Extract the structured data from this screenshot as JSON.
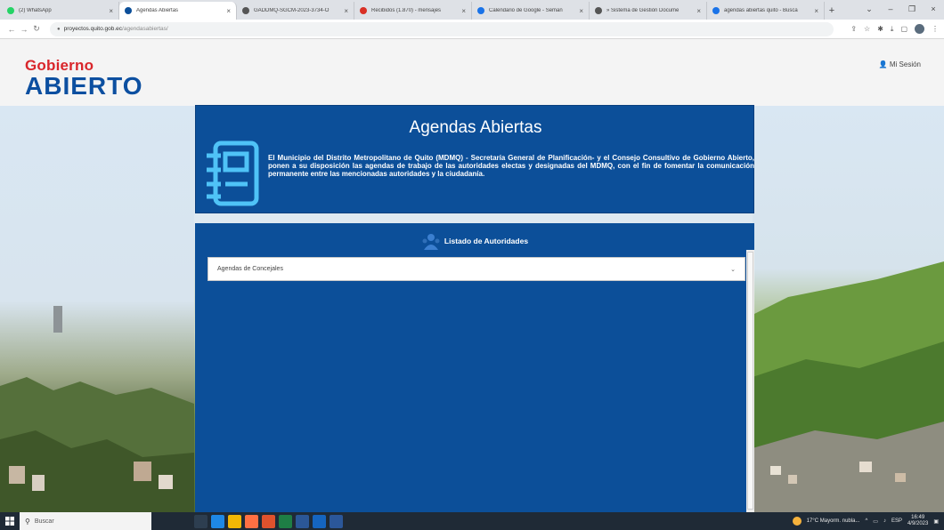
{
  "browser": {
    "tabs": [
      {
        "title": "(2) WhatsApp",
        "color": "#25d366",
        "active": false
      },
      {
        "title": "Agendas Abiertas",
        "color": "#0c4f99",
        "active": true
      },
      {
        "title": "GADDMQ-SGCM-2023-3734-O",
        "color": "#555555",
        "active": false
      },
      {
        "title": "Recibidos (1.870) - mensajes",
        "color": "#d93025",
        "active": false
      },
      {
        "title": "Calendario de Google - Seman",
        "color": "#1a73e8",
        "active": false
      },
      {
        "title": "» Sistema de Gestión Docume",
        "color": "#555555",
        "active": false
      },
      {
        "title": "agendas abiertas quito - Busca",
        "color": "#1a73e8",
        "active": false
      }
    ],
    "new_tab": "+",
    "close_glyph": "×",
    "window_controls": [
      "⌄",
      "–",
      "❐",
      "×"
    ],
    "url_host": "proyectos.quito.gob.ec",
    "url_path": "/agendasabiertas/"
  },
  "header": {
    "logo_top": "Gobierno",
    "logo_bottom": "ABIERTO",
    "session_label": "Mi Sesión"
  },
  "hero": {
    "title": "Agendas Abiertas",
    "description": "El Municipio del Distrito Metropolitano de Quito (MDMQ) - Secretaría General de Planificación- y el Consejo Consultivo de Gobierno Abierto, ponen a su disposición las agendas de trabajo de las autoridades electas y designadas del MDMQ, con el fin de fomentar la comunicación permanente entre las mencionadas autoridades y la ciudadanía."
  },
  "authorities": {
    "title": "Listado de Autoridades",
    "select_value": "Agendas de Concejales"
  },
  "taskbar": {
    "search_placeholder": "Buscar",
    "weather": "17°C Mayorm. nubla...",
    "lang": "ESP",
    "time": "16:49",
    "date": "4/9/2023"
  },
  "colors": {
    "brand_blue": "#0c4f99",
    "brand_red": "#d9262b",
    "icon_cyan": "#4fc3f7"
  }
}
